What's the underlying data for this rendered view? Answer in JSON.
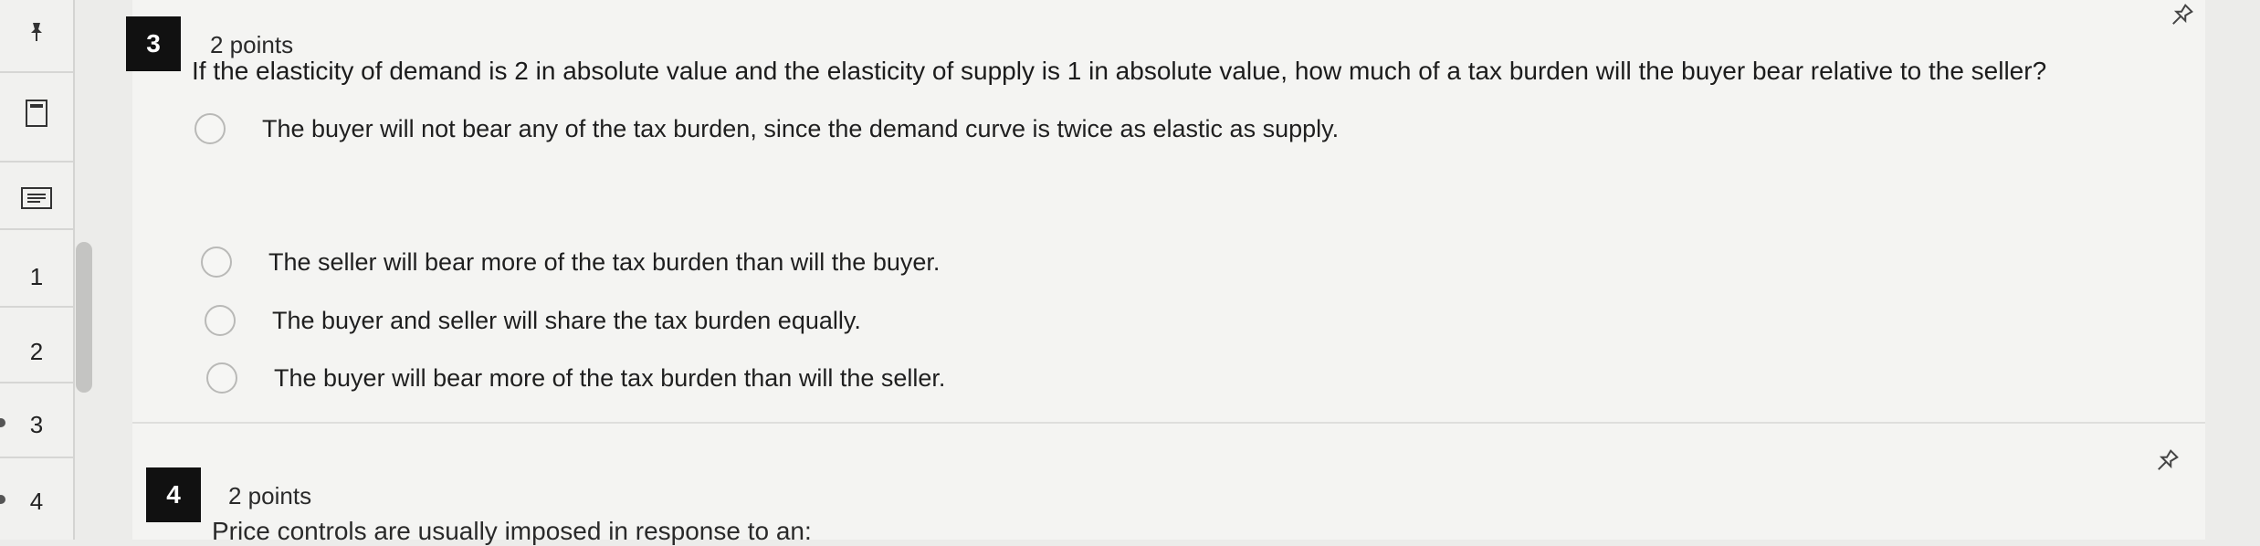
{
  "sidebar": {
    "items": [
      {
        "label": "1"
      },
      {
        "label": "2"
      },
      {
        "label": "3"
      },
      {
        "label": "4"
      }
    ]
  },
  "question3": {
    "number": "3",
    "points": "2 points",
    "text": "If the elasticity of demand is 2 in absolute value and the elasticity of supply is 1 in absolute value, how much of a tax burden will the buyer bear relative to the seller?",
    "options": [
      "The buyer will not bear any of the tax burden, since the demand curve is twice as elastic as supply.",
      "The seller will bear more of the tax burden than will the buyer.",
      "The buyer and seller will share the tax burden equally.",
      "The buyer will bear more of the tax burden than will the seller."
    ]
  },
  "question4": {
    "number": "4",
    "points": "2 points",
    "text": "Price controls are usually imposed in response to an:"
  }
}
